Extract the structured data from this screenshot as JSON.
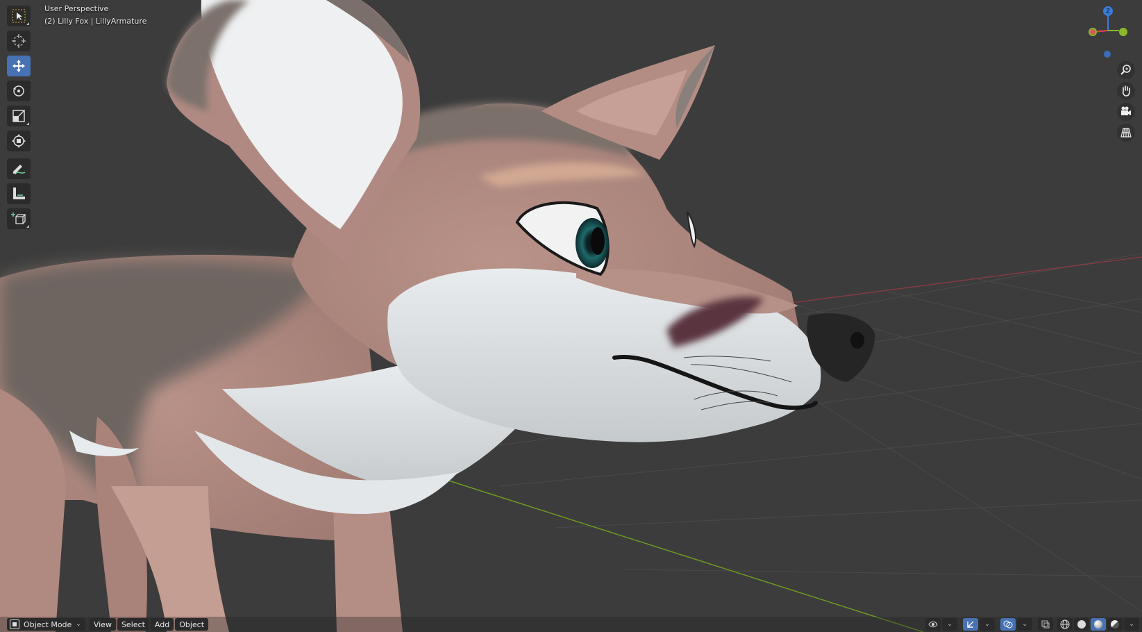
{
  "viewport": {
    "view_name": "User Perspective",
    "object_info": "(2) Lilly Fox | LillyArmature"
  },
  "gizmo": {
    "z_label": "Z"
  },
  "header": {
    "mode": "Object Mode",
    "menus": [
      "View",
      "Select",
      "Add",
      "Object"
    ]
  },
  "colors": {
    "active_tool": "#4772b3",
    "axis_x": "#e4455a",
    "axis_y": "#8ab82c",
    "axis_z": "#3b7bd8",
    "background": "#3c3c3c",
    "fur_pink": "#b48d82",
    "fur_white": "#dde2e4",
    "fur_gray": "#6e6661"
  }
}
